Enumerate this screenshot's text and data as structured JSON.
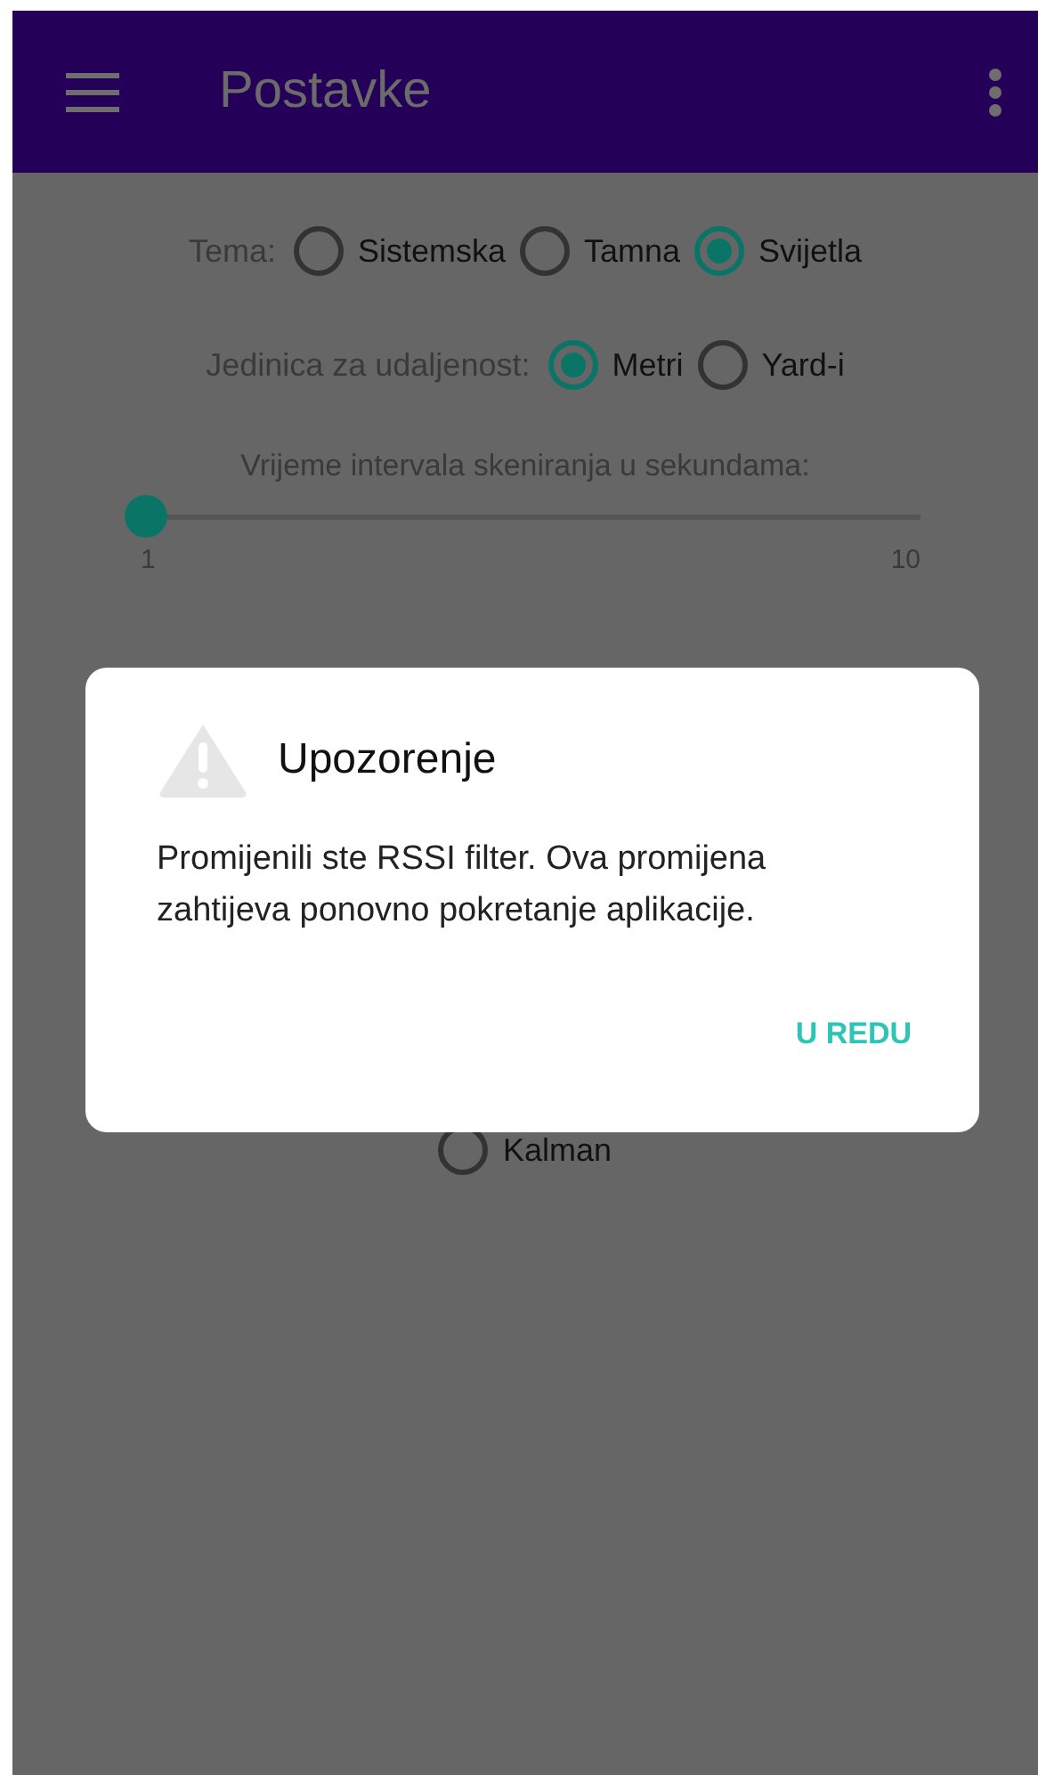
{
  "app_bar": {
    "title": "Postavke"
  },
  "settings": [
    {
      "kind": "radio_group",
      "label": "Tema:",
      "options": [
        {
          "label": "Sistemska",
          "selected": false
        },
        {
          "label": "Tamna",
          "selected": false
        },
        {
          "label": "Svijetla",
          "selected": true
        }
      ]
    },
    {
      "kind": "radio_group",
      "label": "Jedinica za udaljenost:",
      "options": [
        {
          "label": "Metri",
          "selected": true
        },
        {
          "label": "Yard-i",
          "selected": false
        }
      ]
    },
    {
      "kind": "slider",
      "label": "Vrijeme intervala skeniranja u sekundama:",
      "level": 0,
      "min_label": "1",
      "max_label": "10"
    },
    {
      "kind": "radio_group",
      "options": [
        {
          "label": "Kalman",
          "selected": false
        }
      ]
    }
  ],
  "dialog": {
    "title": "Upozorenje",
    "message": "Promijenili ste RSSI filter. Ova promijena zahtijeva ponovno pokretanje aplikacije.",
    "buttons": [
      "U REDU"
    ]
  }
}
